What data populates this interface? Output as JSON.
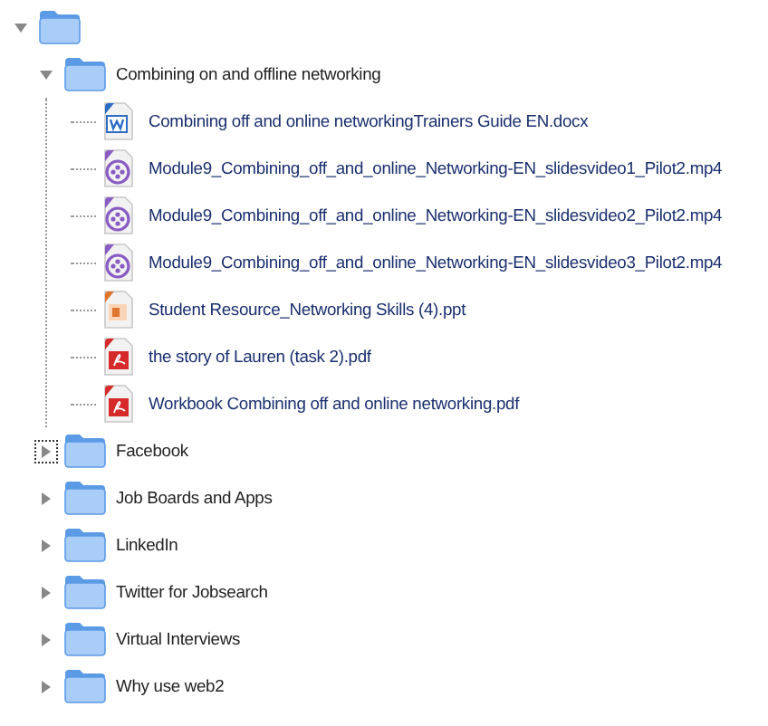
{
  "tree": [
    {
      "kind": "folder",
      "expanded": true,
      "focused": false,
      "children": [
        {
          "kind": "folder",
          "label": "Combining on and offline networking",
          "expanded": true,
          "focused": false,
          "children": [
            {
              "kind": "word",
              "label": "Combining off and online networkingTrainers Guide EN.docx"
            },
            {
              "kind": "video",
              "label": "Module9_Combining_off_and_online_Networking-EN_slidesvideo1_Pilot2.mp4"
            },
            {
              "kind": "video",
              "label": "Module9_Combining_off_and_online_Networking-EN_slidesvideo2_Pilot2.mp4"
            },
            {
              "kind": "video",
              "label": "Module9_Combining_off_and_online_Networking-EN_slidesvideo3_Pilot2.mp4"
            },
            {
              "kind": "slides",
              "label": "Student Resource_Networking Skills (4).ppt"
            },
            {
              "kind": "pdf",
              "label": "the story of Lauren (task 2).pdf"
            },
            {
              "kind": "pdf",
              "label": "Workbook Combining off and online networking.pdf"
            }
          ]
        },
        {
          "kind": "folder",
          "label": "Facebook",
          "expanded": false,
          "focused": true
        },
        {
          "kind": "folder",
          "label": "Job Boards and Apps",
          "expanded": false,
          "focused": false
        },
        {
          "kind": "folder",
          "label": "LinkedIn",
          "expanded": false,
          "focused": false
        },
        {
          "kind": "folder",
          "label": "Twitter for Jobsearch",
          "expanded": false,
          "focused": false
        },
        {
          "kind": "folder",
          "label": "Virtual Interviews",
          "expanded": false,
          "focused": false
        },
        {
          "kind": "folder",
          "label": "Why use web2",
          "expanded": false,
          "focused": false
        }
      ]
    }
  ]
}
